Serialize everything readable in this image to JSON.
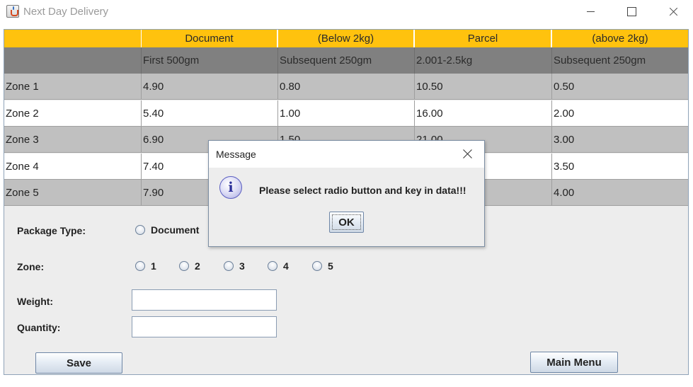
{
  "window": {
    "title": "Next Day Delivery"
  },
  "rate_table": {
    "group_headers": [
      "",
      "Document",
      "(Below 2kg)",
      "Parcel",
      "(above 2kg)"
    ],
    "sub_headers": [
      "",
      "First 500gm",
      "Subsequent 250gm",
      "2.001-2.5kg",
      "Subsequent 250gm"
    ],
    "rows": [
      [
        "Zone 1",
        "4.90",
        "0.80",
        "10.50",
        "0.50"
      ],
      [
        "Zone 2",
        "5.40",
        "1.00",
        "16.00",
        "2.00"
      ],
      [
        "Zone 3",
        "6.90",
        "1.50",
        "21.00",
        "3.00"
      ],
      [
        "Zone 4",
        "7.40",
        "",
        "",
        "3.50"
      ],
      [
        "Zone 5",
        "7.90",
        "",
        "",
        "4.00"
      ]
    ]
  },
  "form": {
    "package_type_label": "Package Type:",
    "package_options": [
      "Document"
    ],
    "zone_label": "Zone:",
    "zone_options": [
      "1",
      "2",
      "3",
      "4",
      "5"
    ],
    "weight_label": "Weight:",
    "quantity_label": "Quantity:",
    "weight_value": "",
    "quantity_value": "",
    "save_label": "Save",
    "main_menu_label": "Main Menu"
  },
  "dialog": {
    "title": "Message",
    "message": "Please select radio button and key in data!!!",
    "icon_glyph": "i",
    "ok_label": "OK"
  }
}
